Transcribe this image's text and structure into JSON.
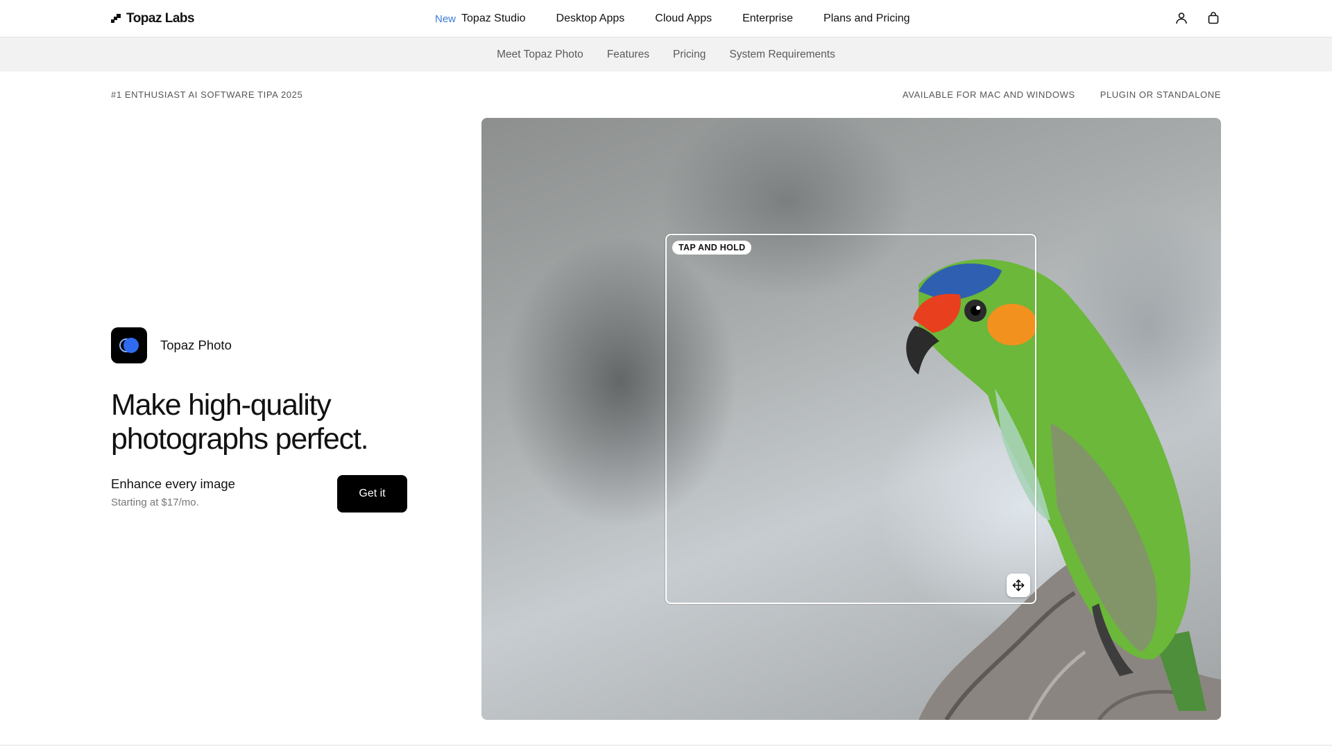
{
  "brand": {
    "name": "Topaz Labs"
  },
  "nav": {
    "items": [
      {
        "badge": "New",
        "label": "Topaz Studio"
      },
      {
        "label": "Desktop Apps"
      },
      {
        "label": "Cloud Apps"
      },
      {
        "label": "Enterprise"
      },
      {
        "label": "Plans and Pricing"
      }
    ],
    "icons": [
      "user-icon",
      "shopping-bag-icon"
    ]
  },
  "subnav": {
    "items": [
      {
        "label": "Meet Topaz Photo"
      },
      {
        "label": "Features"
      },
      {
        "label": "Pricing"
      },
      {
        "label": "System Requirements"
      }
    ]
  },
  "meta": {
    "award": "#1 ENTHUSIAST AI SOFTWARE TIPA 2025",
    "platforms": "AVAILABLE FOR MAC AND WINDOWS",
    "mode": "PLUGIN OR STANDALONE"
  },
  "product": {
    "name": "Topaz Photo",
    "headline": "Make high-quality photographs perfect.",
    "offer_title": "Enhance every image",
    "offer_price": "Starting at $17/mo.",
    "cta_label": "Get it"
  },
  "hero": {
    "compare_label": "TAP AND HOLD",
    "handle_icon": "move-arrows-icon"
  },
  "colors": {
    "accent_new": "#3a7bd5",
    "cta_bg": "#000000",
    "subnav_bg": "#f2f2f2",
    "product_icon_blue": "#2e6bf0"
  }
}
